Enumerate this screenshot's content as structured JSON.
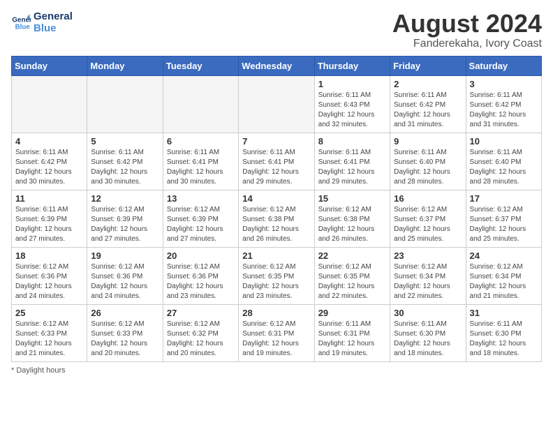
{
  "header": {
    "logo_line1": "General",
    "logo_line2": "Blue",
    "month_year": "August 2024",
    "location": "Fanderekaha, Ivory Coast"
  },
  "weekdays": [
    "Sunday",
    "Monday",
    "Tuesday",
    "Wednesday",
    "Thursday",
    "Friday",
    "Saturday"
  ],
  "weeks": [
    [
      {
        "day": "",
        "info": ""
      },
      {
        "day": "",
        "info": ""
      },
      {
        "day": "",
        "info": ""
      },
      {
        "day": "",
        "info": ""
      },
      {
        "day": "1",
        "info": "Sunrise: 6:11 AM\nSunset: 6:43 PM\nDaylight: 12 hours\nand 32 minutes."
      },
      {
        "day": "2",
        "info": "Sunrise: 6:11 AM\nSunset: 6:42 PM\nDaylight: 12 hours\nand 31 minutes."
      },
      {
        "day": "3",
        "info": "Sunrise: 6:11 AM\nSunset: 6:42 PM\nDaylight: 12 hours\nand 31 minutes."
      }
    ],
    [
      {
        "day": "4",
        "info": "Sunrise: 6:11 AM\nSunset: 6:42 PM\nDaylight: 12 hours\nand 30 minutes."
      },
      {
        "day": "5",
        "info": "Sunrise: 6:11 AM\nSunset: 6:42 PM\nDaylight: 12 hours\nand 30 minutes."
      },
      {
        "day": "6",
        "info": "Sunrise: 6:11 AM\nSunset: 6:41 PM\nDaylight: 12 hours\nand 30 minutes."
      },
      {
        "day": "7",
        "info": "Sunrise: 6:11 AM\nSunset: 6:41 PM\nDaylight: 12 hours\nand 29 minutes."
      },
      {
        "day": "8",
        "info": "Sunrise: 6:11 AM\nSunset: 6:41 PM\nDaylight: 12 hours\nand 29 minutes."
      },
      {
        "day": "9",
        "info": "Sunrise: 6:11 AM\nSunset: 6:40 PM\nDaylight: 12 hours\nand 28 minutes."
      },
      {
        "day": "10",
        "info": "Sunrise: 6:11 AM\nSunset: 6:40 PM\nDaylight: 12 hours\nand 28 minutes."
      }
    ],
    [
      {
        "day": "11",
        "info": "Sunrise: 6:11 AM\nSunset: 6:39 PM\nDaylight: 12 hours\nand 27 minutes."
      },
      {
        "day": "12",
        "info": "Sunrise: 6:12 AM\nSunset: 6:39 PM\nDaylight: 12 hours\nand 27 minutes."
      },
      {
        "day": "13",
        "info": "Sunrise: 6:12 AM\nSunset: 6:39 PM\nDaylight: 12 hours\nand 27 minutes."
      },
      {
        "day": "14",
        "info": "Sunrise: 6:12 AM\nSunset: 6:38 PM\nDaylight: 12 hours\nand 26 minutes."
      },
      {
        "day": "15",
        "info": "Sunrise: 6:12 AM\nSunset: 6:38 PM\nDaylight: 12 hours\nand 26 minutes."
      },
      {
        "day": "16",
        "info": "Sunrise: 6:12 AM\nSunset: 6:37 PM\nDaylight: 12 hours\nand 25 minutes."
      },
      {
        "day": "17",
        "info": "Sunrise: 6:12 AM\nSunset: 6:37 PM\nDaylight: 12 hours\nand 25 minutes."
      }
    ],
    [
      {
        "day": "18",
        "info": "Sunrise: 6:12 AM\nSunset: 6:36 PM\nDaylight: 12 hours\nand 24 minutes."
      },
      {
        "day": "19",
        "info": "Sunrise: 6:12 AM\nSunset: 6:36 PM\nDaylight: 12 hours\nand 24 minutes."
      },
      {
        "day": "20",
        "info": "Sunrise: 6:12 AM\nSunset: 6:36 PM\nDaylight: 12 hours\nand 23 minutes."
      },
      {
        "day": "21",
        "info": "Sunrise: 6:12 AM\nSunset: 6:35 PM\nDaylight: 12 hours\nand 23 minutes."
      },
      {
        "day": "22",
        "info": "Sunrise: 6:12 AM\nSunset: 6:35 PM\nDaylight: 12 hours\nand 22 minutes."
      },
      {
        "day": "23",
        "info": "Sunrise: 6:12 AM\nSunset: 6:34 PM\nDaylight: 12 hours\nand 22 minutes."
      },
      {
        "day": "24",
        "info": "Sunrise: 6:12 AM\nSunset: 6:34 PM\nDaylight: 12 hours\nand 21 minutes."
      }
    ],
    [
      {
        "day": "25",
        "info": "Sunrise: 6:12 AM\nSunset: 6:33 PM\nDaylight: 12 hours\nand 21 minutes."
      },
      {
        "day": "26",
        "info": "Sunrise: 6:12 AM\nSunset: 6:33 PM\nDaylight: 12 hours\nand 20 minutes."
      },
      {
        "day": "27",
        "info": "Sunrise: 6:12 AM\nSunset: 6:32 PM\nDaylight: 12 hours\nand 20 minutes."
      },
      {
        "day": "28",
        "info": "Sunrise: 6:12 AM\nSunset: 6:31 PM\nDaylight: 12 hours\nand 19 minutes."
      },
      {
        "day": "29",
        "info": "Sunrise: 6:11 AM\nSunset: 6:31 PM\nDaylight: 12 hours\nand 19 minutes."
      },
      {
        "day": "30",
        "info": "Sunrise: 6:11 AM\nSunset: 6:30 PM\nDaylight: 12 hours\nand 18 minutes."
      },
      {
        "day": "31",
        "info": "Sunrise: 6:11 AM\nSunset: 6:30 PM\nDaylight: 12 hours\nand 18 minutes."
      }
    ]
  ],
  "footer": "Daylight hours"
}
